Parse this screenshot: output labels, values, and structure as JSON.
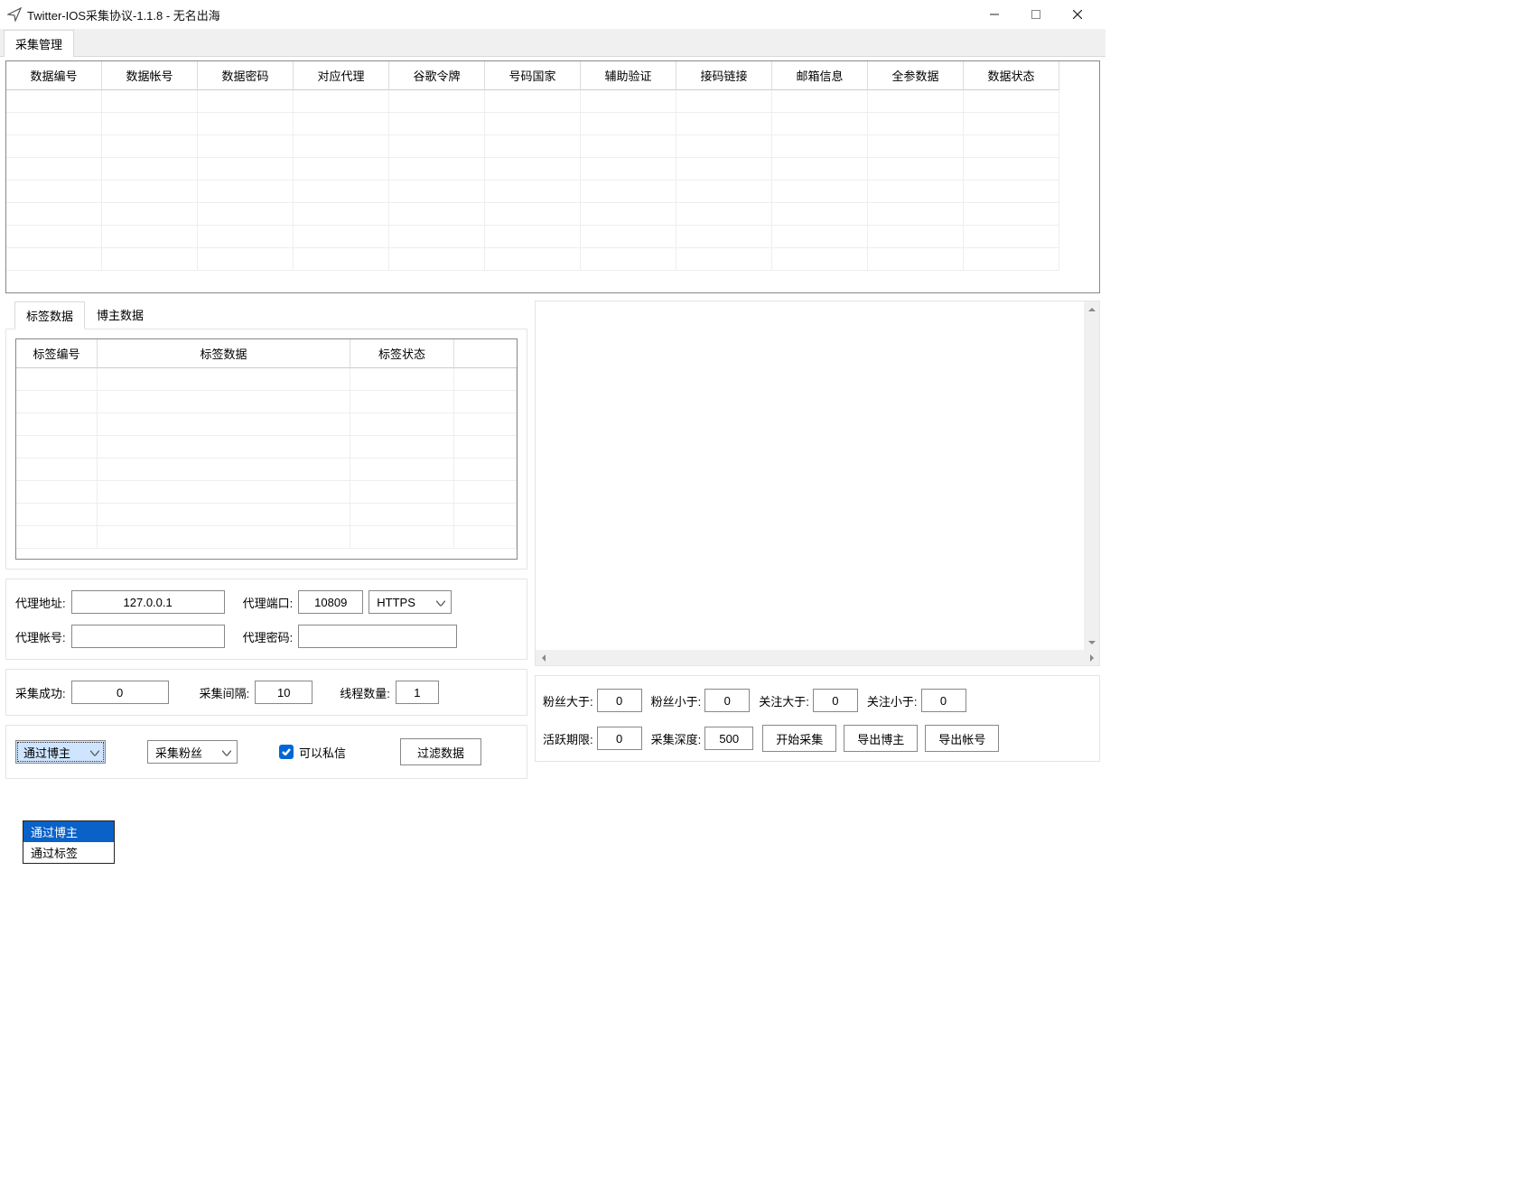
{
  "window": {
    "title": "Twitter-IOS采集协议-1.1.8 - 无名出海"
  },
  "main_tab": {
    "label": "采集管理"
  },
  "top_grid": {
    "columns": [
      "数据编号",
      "数据帐号",
      "数据密码",
      "对应代理",
      "谷歌令牌",
      "号码国家",
      "辅助验证",
      "接码链接",
      "邮箱信息",
      "全参数据",
      "数据状态"
    ]
  },
  "sub_tabs": {
    "tab1": "标签数据",
    "tab2": "博主数据"
  },
  "sub_grid": {
    "col1": "标签编号",
    "col2": "标签数据",
    "col3": "标签状态"
  },
  "proxy": {
    "addr_label": "代理地址:",
    "addr_value": "127.0.0.1",
    "port_label": "代理端口:",
    "port_value": "10809",
    "protocol": "HTTPS",
    "user_label": "代理帐号:",
    "user_value": "",
    "pass_label": "代理密码:",
    "pass_value": ""
  },
  "collect": {
    "success_label": "采集成功:",
    "success_value": "0",
    "interval_label": "采集间隔:",
    "interval_value": "10",
    "threads_label": "线程数量:",
    "threads_value": "1"
  },
  "mode": {
    "by_select_value": "通过博主",
    "opt1": "通过博主",
    "opt2": "通过标签",
    "fans_select_value": "采集粉丝",
    "dm_label": "可以私信",
    "filter_btn": "过滤数据"
  },
  "filters": {
    "fans_gt_label": "粉丝大于:",
    "fans_gt_value": "0",
    "fans_lt_label": "粉丝小于:",
    "fans_lt_value": "0",
    "follow_gt_label": "关注大于:",
    "follow_gt_value": "0",
    "follow_lt_label": "关注小于:",
    "follow_lt_value": "0",
    "active_label": "活跃期限:",
    "active_value": "0",
    "depth_label": "采集深度:",
    "depth_value": "500",
    "start_btn": "开始采集",
    "export_blogger_btn": "导出博主",
    "export_account_btn": "导出帐号"
  }
}
